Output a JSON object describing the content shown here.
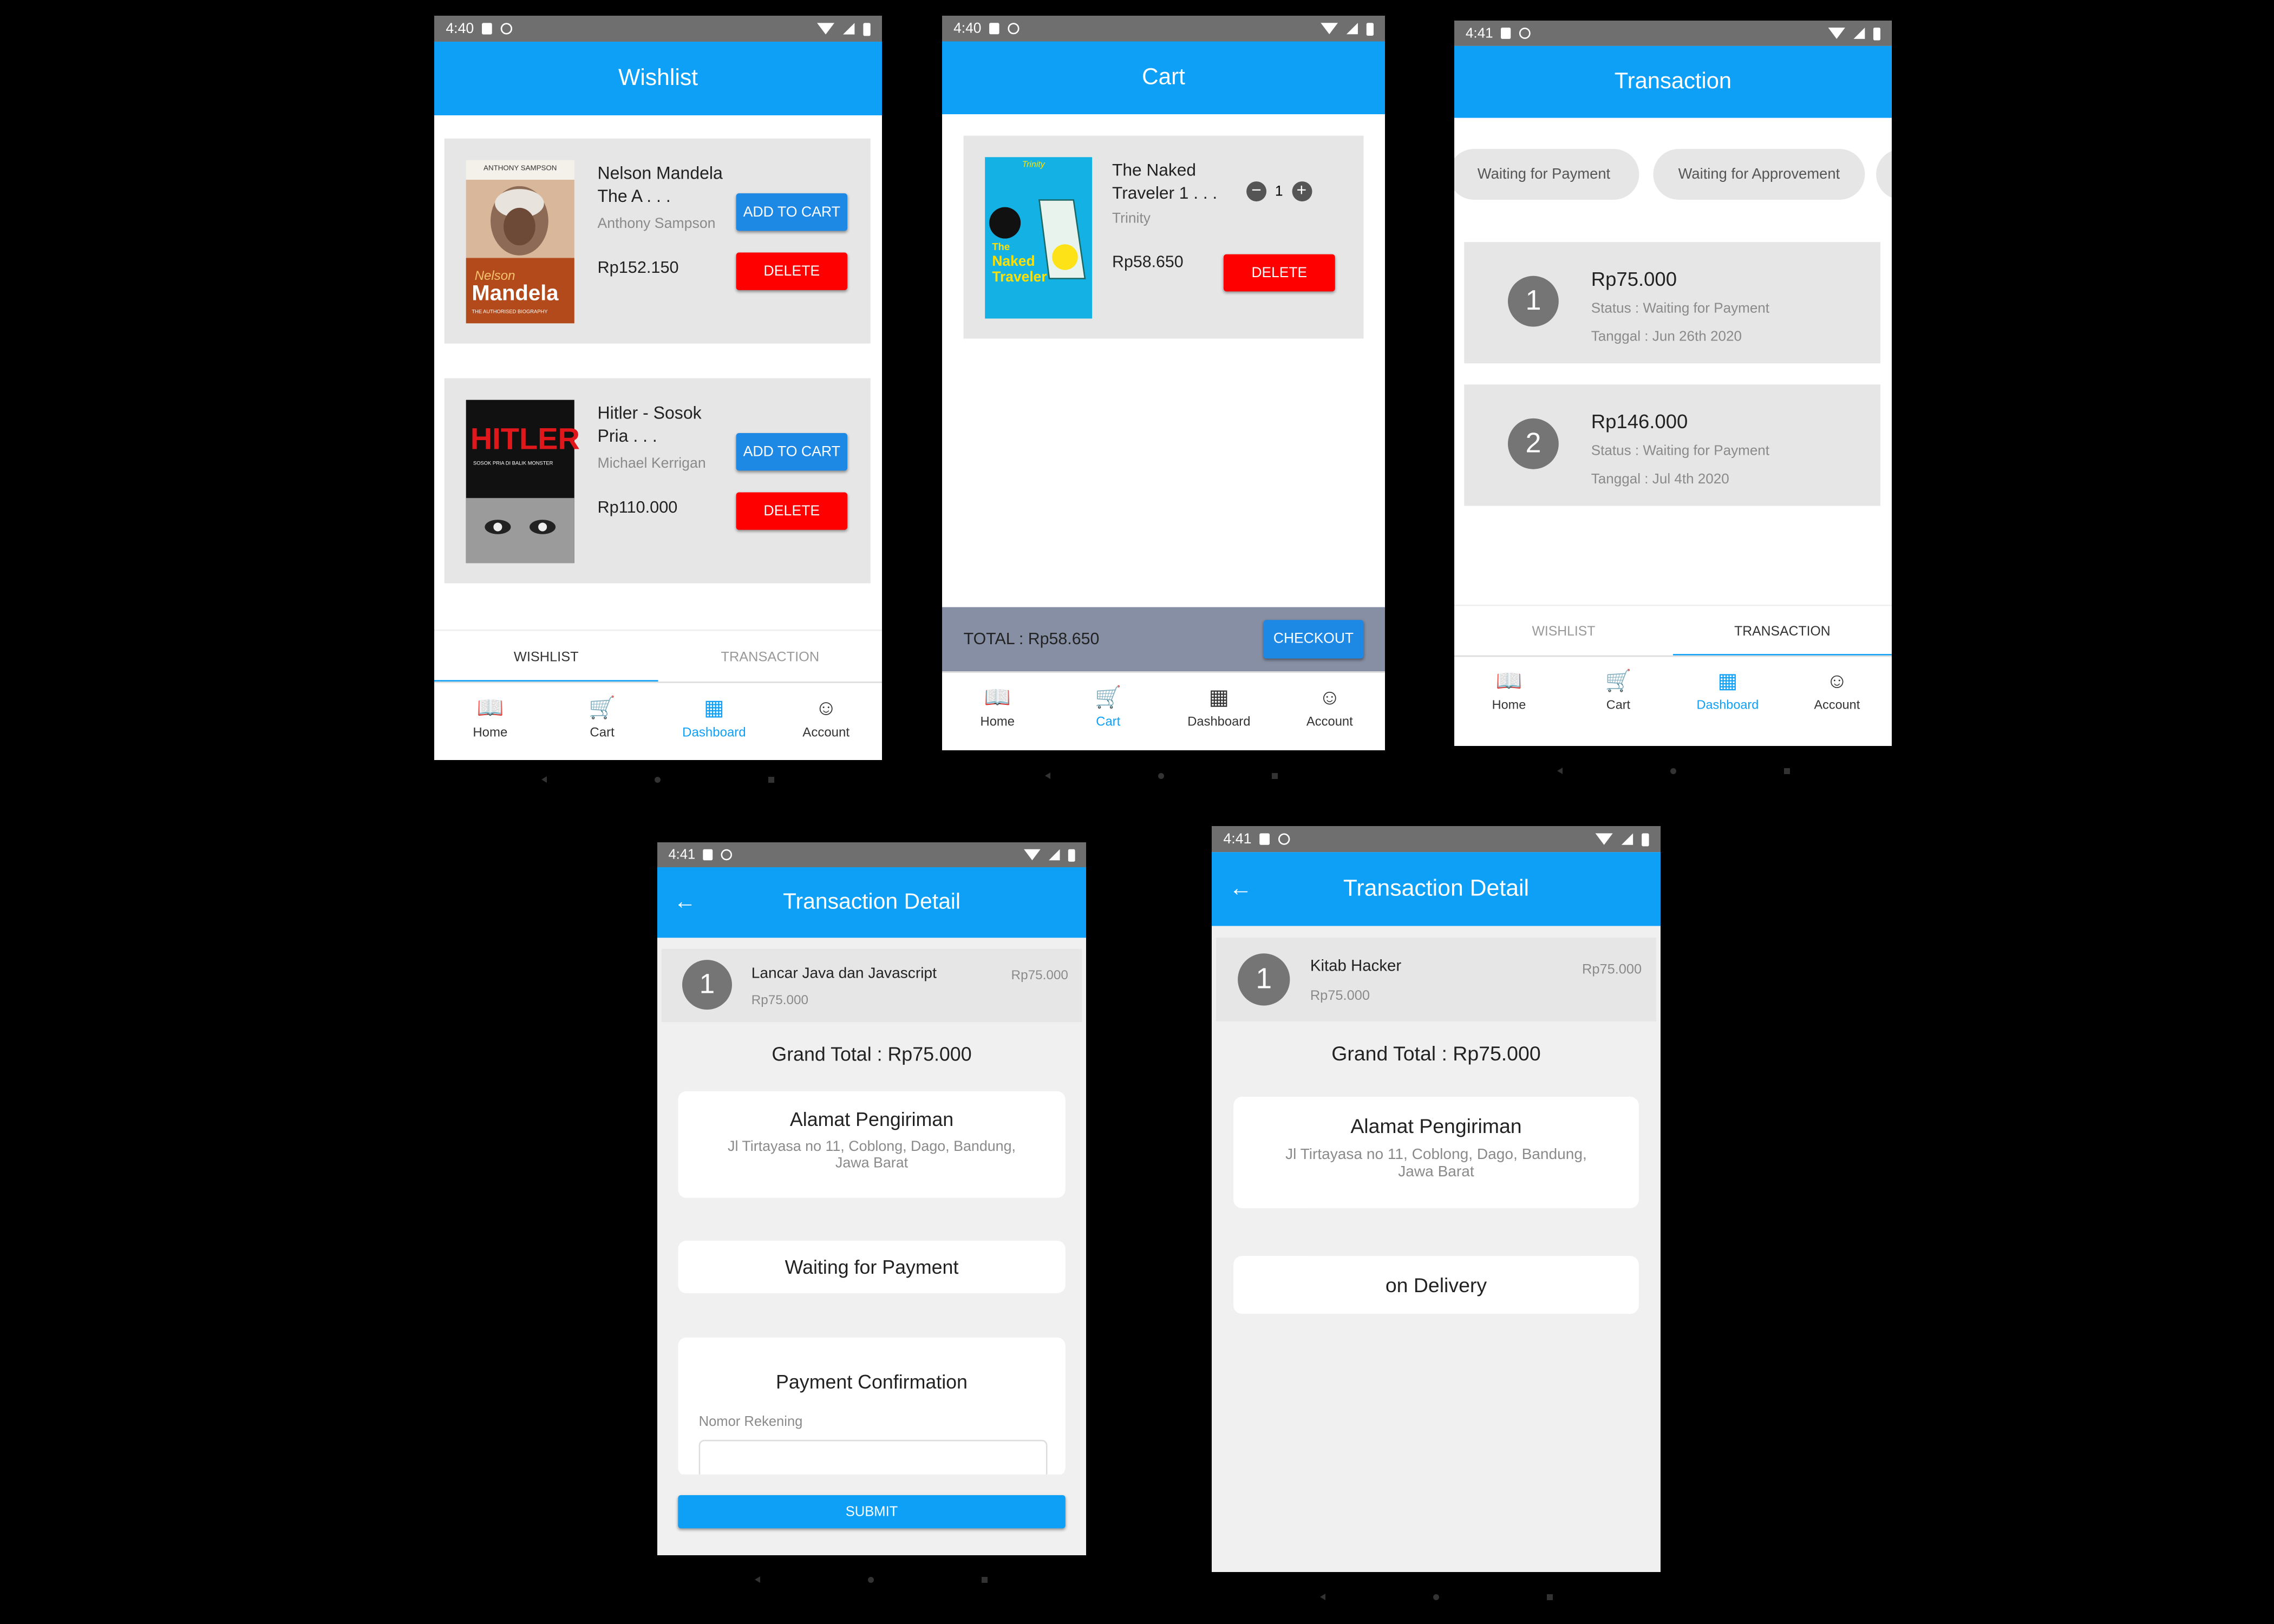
{
  "status": {
    "s1": "4:40",
    "s2": "4:40",
    "s3": "4:41",
    "s4": "4:41",
    "s5": "4:41"
  },
  "wishlist": {
    "title": "Wishlist",
    "items": [
      {
        "title_line1": "Nelson Mandela",
        "title_line2": "The A . . .",
        "author": "Anthony Sampson",
        "price": "Rp152.150",
        "add_label": "ADD TO CART",
        "delete_label": "DELETE",
        "cover_top": "ANTHONY SAMPSON",
        "cover_line1": "Nelson",
        "cover_line2": "Mandela",
        "cover_sub": "THE AUTHORISED BIOGRAPHY"
      },
      {
        "title_line1": "Hitler - Sosok",
        "title_line2": "Pria  . . .",
        "author": "Michael Kerrigan",
        "price": "Rp110.000",
        "add_label": "ADD TO CART",
        "delete_label": "DELETE",
        "cover_line1": "HITLER",
        "cover_sub": "SOSOK PRIA DI BALIK MONSTER"
      }
    ],
    "tabs": [
      "WISHLIST",
      "TRANSACTION"
    ]
  },
  "bottom_nav": {
    "home": "Home",
    "cart": "Cart",
    "dashboard": "Dashboard",
    "account": "Account"
  },
  "cart": {
    "title": "Cart",
    "item": {
      "title_line1": "The Naked",
      "title_line2": "Traveler 1 . . .",
      "author": "Trinity",
      "price": "Rp58.650",
      "qty": "1",
      "delete_label": "DELETE",
      "cover_brand": "Trinity",
      "cover_line1": "The",
      "cover_line2": "Naked",
      "cover_line3": "Traveler"
    },
    "total": "TOTAL : Rp58.650",
    "checkout_label": "CHECKOUT"
  },
  "transaction": {
    "title": "Transaction",
    "chips": [
      "Waiting for Payment",
      "Waiting for Approvement"
    ],
    "items": [
      {
        "num": "1",
        "amount": "Rp75.000",
        "status": "Status : Waiting for Payment",
        "date": "Tanggal : Jun 26th 2020"
      },
      {
        "num": "2",
        "amount": "Rp146.000",
        "status": "Status : Waiting for Payment",
        "date": "Tanggal : Jul 4th 2020"
      }
    ],
    "tabs": [
      "WISHLIST",
      "TRANSACTION"
    ]
  },
  "detail1": {
    "title": "Transaction Detail",
    "item": {
      "num": "1",
      "name": "Lancar Java dan Javascript",
      "price": "Rp75.000",
      "right_price": "Rp75.000"
    },
    "grand_total": "Grand Total : Rp75.000",
    "address_title": "Alamat Pengiriman",
    "address_line1": "Jl Tirtayasa no 11, Coblong, Dago, Bandung,",
    "address_line2": "Jawa Barat",
    "status": "Waiting for Payment",
    "payment_title": "Payment Confirmation",
    "rekening_label": "Nomor Rekening",
    "submit_label": "SUBMIT"
  },
  "detail2": {
    "title": "Transaction Detail",
    "item": {
      "num": "1",
      "name": "Kitab Hacker",
      "price": "Rp75.000",
      "right_price": "Rp75.000"
    },
    "grand_total": "Grand Total : Rp75.000",
    "address_title": "Alamat Pengiriman",
    "address_line1": "Jl Tirtayasa no 11, Coblong, Dago, Bandung,",
    "address_line2": "Jawa Barat",
    "status": "on Delivery"
  },
  "colors": {
    "appbar": "#0ea0f7",
    "delete": "#ff0000",
    "button": "#1e88e5",
    "card": "#e6e6e6"
  }
}
